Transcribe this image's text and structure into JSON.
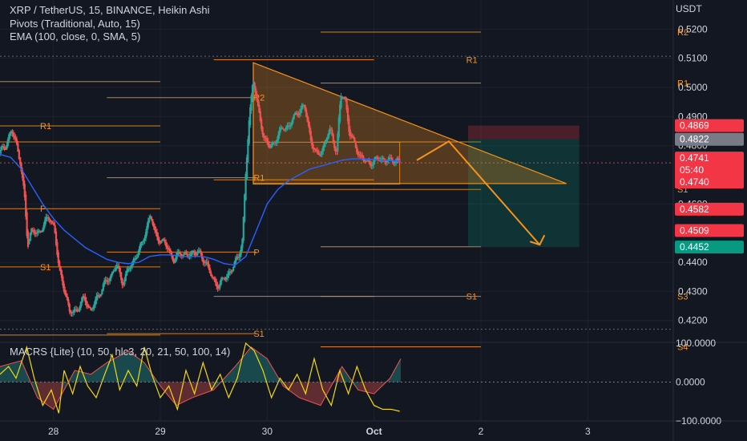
{
  "legend": {
    "symbol": "XRP / TetherUS, 15, BINANCE, Heikin Ashi",
    "pivots": "Pivots (Traditional, Auto, 15)",
    "ema": "EMA (100, close, 0, SMA, 5)",
    "macrs": "MACRS {Lite} (10, 50, hlc3, 20, 21, 50, 100, 14)"
  },
  "colors": {
    "background": "#131722",
    "bull": "#26a69a",
    "bear": "#ef5350",
    "ema": "#2962ff",
    "pivot": "#f7931a",
    "triangle_fill": "#f7931a",
    "stop_zone": "#f23645",
    "target_zone": "#089981"
  },
  "chart_data": [
    {
      "type": "candlestick",
      "title": "XRP / TetherUS, 15, BINANCE, Heikin Ashi",
      "ylabel": "USDT",
      "ylim": [
        0.4125,
        0.53
      ],
      "y_ticks": [
        "0.5200",
        "0.5100",
        "0.5000",
        "0.4900",
        "0.4800",
        "0.4600",
        "0.4400",
        "0.4300",
        "0.4200"
      ],
      "x_ticks": [
        "28",
        "29",
        "30",
        "Oct",
        "2",
        "3"
      ],
      "x_tick_pos": [
        0.5,
        1.5,
        2.5,
        3.5,
        4.5,
        5.5
      ],
      "xlim": [
        0.0,
        6.3
      ],
      "price_path": [
        [
          0.0,
          0.4775
        ],
        [
          0.06,
          0.48
        ],
        [
          0.12,
          0.485
        ],
        [
          0.16,
          0.4815
        ],
        [
          0.2,
          0.4745
        ],
        [
          0.24,
          0.462
        ],
        [
          0.27,
          0.446
        ],
        [
          0.3,
          0.451
        ],
        [
          0.36,
          0.4495
        ],
        [
          0.42,
          0.453
        ],
        [
          0.47,
          0.4555
        ],
        [
          0.52,
          0.452
        ],
        [
          0.56,
          0.438
        ],
        [
          0.62,
          0.43
        ],
        [
          0.66,
          0.4225
        ],
        [
          0.74,
          0.424
        ],
        [
          0.8,
          0.428
        ],
        [
          0.86,
          0.423
        ],
        [
          0.92,
          0.428
        ],
        [
          0.98,
          0.432
        ],
        [
          1.04,
          0.435
        ],
        [
          1.1,
          0.439
        ],
        [
          1.16,
          0.433
        ],
        [
          1.22,
          0.438
        ],
        [
          1.28,
          0.442
        ],
        [
          1.34,
          0.446
        ],
        [
          1.38,
          0.452
        ],
        [
          1.42,
          0.456
        ],
        [
          1.46,
          0.45
        ],
        [
          1.52,
          0.447
        ],
        [
          1.58,
          0.4455
        ],
        [
          1.64,
          0.44
        ],
        [
          1.7,
          0.444
        ],
        [
          1.76,
          0.4415
        ],
        [
          1.82,
          0.444
        ],
        [
          1.88,
          0.4425
        ],
        [
          1.94,
          0.44
        ],
        [
          2.0,
          0.434
        ],
        [
          2.06,
          0.432
        ],
        [
          2.12,
          0.435
        ],
        [
          2.18,
          0.4375
        ],
        [
          2.24,
          0.442
        ],
        [
          2.28,
          0.448
        ],
        [
          2.31,
          0.47
        ],
        [
          2.34,
          0.488
        ],
        [
          2.38,
          0.504
        ],
        [
          2.42,
          0.493
        ],
        [
          2.48,
          0.483
        ],
        [
          2.54,
          0.479
        ],
        [
          2.6,
          0.483
        ],
        [
          2.66,
          0.486
        ],
        [
          2.72,
          0.487
        ],
        [
          2.8,
          0.492
        ],
        [
          2.86,
          0.4935
        ],
        [
          2.92,
          0.482
        ],
        [
          2.98,
          0.476
        ],
        [
          3.04,
          0.48
        ],
        [
          3.1,
          0.4855
        ],
        [
          3.16,
          0.478
        ],
        [
          3.2,
          0.497
        ],
        [
          3.24,
          0.497
        ],
        [
          3.28,
          0.484
        ],
        [
          3.34,
          0.48
        ],
        [
          3.38,
          0.476
        ],
        [
          3.44,
          0.4745
        ],
        [
          3.5,
          0.474
        ],
        [
          3.56,
          0.476
        ],
        [
          3.62,
          0.4745
        ],
        [
          3.68,
          0.4755
        ],
        [
          3.74,
          0.4741
        ]
      ],
      "ema_path": [
        [
          0.0,
          0.477
        ],
        [
          0.1,
          0.476
        ],
        [
          0.2,
          0.472
        ],
        [
          0.3,
          0.466
        ],
        [
          0.4,
          0.46
        ],
        [
          0.5,
          0.455
        ],
        [
          0.6,
          0.451
        ],
        [
          0.7,
          0.448
        ],
        [
          0.8,
          0.445
        ],
        [
          0.9,
          0.443
        ],
        [
          1.0,
          0.441
        ],
        [
          1.1,
          0.44
        ],
        [
          1.2,
          0.4395
        ],
        [
          1.3,
          0.44
        ],
        [
          1.4,
          0.442
        ],
        [
          1.5,
          0.4425
        ],
        [
          1.6,
          0.4425
        ],
        [
          1.7,
          0.442
        ],
        [
          1.8,
          0.442
        ],
        [
          1.9,
          0.442
        ],
        [
          2.0,
          0.441
        ],
        [
          2.1,
          0.4395
        ],
        [
          2.2,
          0.439
        ],
        [
          2.3,
          0.442
        ],
        [
          2.4,
          0.451
        ],
        [
          2.5,
          0.46
        ],
        [
          2.6,
          0.465
        ],
        [
          2.7,
          0.468
        ],
        [
          2.8,
          0.47
        ],
        [
          2.9,
          0.472
        ],
        [
          3.0,
          0.473
        ],
        [
          3.1,
          0.474
        ],
        [
          3.2,
          0.475
        ],
        [
          3.3,
          0.4755
        ],
        [
          3.4,
          0.4755
        ],
        [
          3.5,
          0.4752
        ],
        [
          3.6,
          0.475
        ],
        [
          3.7,
          0.4748
        ],
        [
          3.75,
          0.4747
        ]
      ],
      "pivot_sets": [
        {
          "x0": 0.0,
          "x1": 1.5,
          "levels": [
            {
              "label": "R1",
              "value": 0.4868
            },
            {
              "label": "P",
              "value": 0.4584
            },
            {
              "label": "S1",
              "value": 0.4384
            },
            {
              "label": "",
              "value": 0.415
            },
            {
              "label": "",
              "value": 0.502
            },
            {
              "label": "",
              "value": 0.4813
            }
          ]
        },
        {
          "x0": 1.0,
          "x1": 2.4,
          "levels": [
            {
              "label": "R2",
              "value": 0.4965
            },
            {
              "label": "R1",
              "value": 0.469
            },
            {
              "label": "P",
              "value": 0.4435
            },
            {
              "label": "S1",
              "value": 0.4155
            }
          ]
        },
        {
          "x0": 2.0,
          "x1": 3.5,
          "levels": [
            {
              "label": "R1",
              "value": 0.5095
            },
            {
              "label": "",
              "value": 0.4683
            },
            {
              "label": "S1",
              "value": 0.4283
            }
          ]
        },
        {
          "x0": 3.0,
          "x1": 4.5,
          "levels": [
            {
              "label": "R2",
              "value": 0.519
            },
            {
              "label": "R1",
              "value": 0.5015
            },
            {
              "label": "",
              "value": 0.4813
            },
            {
              "label": "S1",
              "value": 0.465
            },
            {
              "label": "S2",
              "value": 0.4453
            },
            {
              "label": "S3",
              "value": 0.4283
            },
            {
              "label": "S4",
              "value": 0.411
            }
          ]
        }
      ],
      "triangle": [
        [
          2.37,
          0.5085
        ],
        [
          5.3,
          0.467
        ],
        [
          2.37,
          0.467
        ]
      ],
      "range_box": [
        2.37,
        3.74,
        0.4668,
        0.4812
      ],
      "position": {
        "x0": 4.38,
        "x1": 5.42,
        "entry": 0.4822,
        "stop": 0.4869,
        "target": 0.4452
      },
      "forecast_path": [
        [
          3.9,
          0.475
        ],
        [
          4.2,
          0.4815
        ],
        [
          5.05,
          0.446
        ]
      ],
      "price_badges": [
        {
          "text": "0.4869",
          "value": 0.4869,
          "color": "#f23645"
        },
        {
          "text": "0.4822",
          "value": 0.4822,
          "color": "#787b86"
        },
        {
          "text": "0.4741\n05:40\n0.4740",
          "value": 0.4741,
          "color": "#f23645"
        },
        {
          "text": "0.4582",
          "value": 0.4582,
          "color": "#f23645"
        },
        {
          "text": "0.4509",
          "value": 0.4509,
          "color": "#f23645"
        },
        {
          "text": "0.4452",
          "value": 0.4452,
          "color": "#089981"
        }
      ],
      "dotted_levels": [
        0.5107,
        0.4741,
        0.417
      ]
    },
    {
      "type": "area",
      "title": "MACRS {Lite} (10, 50, hlc3, 20, 21, 50, 100, 14)",
      "ylim": [
        -100,
        100
      ],
      "y_ticks": [
        "100.0000",
        "0.0000",
        "−100.0000"
      ],
      "y_tick_values": [
        100,
        0,
        -100
      ],
      "histogram": [
        [
          0.0,
          40
        ],
        [
          0.2,
          55
        ],
        [
          0.35,
          -40
        ],
        [
          0.5,
          -70
        ],
        [
          0.6,
          -20
        ],
        [
          0.7,
          30
        ],
        [
          0.85,
          20
        ],
        [
          1.0,
          50
        ],
        [
          1.2,
          80
        ],
        [
          1.35,
          50
        ],
        [
          1.5,
          -10
        ],
        [
          1.65,
          -60
        ],
        [
          1.8,
          -40
        ],
        [
          2.0,
          -20
        ],
        [
          2.2,
          40
        ],
        [
          2.35,
          90
        ],
        [
          2.5,
          60
        ],
        [
          2.65,
          -10
        ],
        [
          2.8,
          -40
        ],
        [
          3.0,
          -60
        ],
        [
          3.2,
          40
        ],
        [
          3.35,
          -20
        ],
        [
          3.5,
          -30
        ],
        [
          3.65,
          10
        ],
        [
          3.75,
          60
        ]
      ],
      "signal": [
        [
          0.0,
          20
        ],
        [
          0.08,
          40
        ],
        [
          0.15,
          10
        ],
        [
          0.25,
          90
        ],
        [
          0.32,
          10
        ],
        [
          0.4,
          -60
        ],
        [
          0.48,
          -20
        ],
        [
          0.55,
          -80
        ],
        [
          0.6,
          30
        ],
        [
          0.68,
          -30
        ],
        [
          0.75,
          40
        ],
        [
          0.82,
          -10
        ],
        [
          0.9,
          -40
        ],
        [
          0.98,
          20
        ],
        [
          1.05,
          70
        ],
        [
          1.12,
          -20
        ],
        [
          1.2,
          30
        ],
        [
          1.28,
          -10
        ],
        [
          1.35,
          90
        ],
        [
          1.42,
          20
        ],
        [
          1.5,
          -40
        ],
        [
          1.58,
          -10
        ],
        [
          1.66,
          -70
        ],
        [
          1.74,
          30
        ],
        [
          1.82,
          -30
        ],
        [
          1.9,
          50
        ],
        [
          1.98,
          -20
        ],
        [
          2.06,
          20
        ],
        [
          2.14,
          -40
        ],
        [
          2.22,
          10
        ],
        [
          2.3,
          100
        ],
        [
          2.38,
          80
        ],
        [
          2.46,
          30
        ],
        [
          2.54,
          -40
        ],
        [
          2.62,
          10
        ],
        [
          2.7,
          -20
        ],
        [
          2.78,
          20
        ],
        [
          2.86,
          -30
        ],
        [
          2.94,
          60
        ],
        [
          3.02,
          -20
        ],
        [
          3.1,
          -60
        ],
        [
          3.18,
          30
        ],
        [
          3.26,
          -30
        ],
        [
          3.34,
          40
        ],
        [
          3.42,
          -20
        ],
        [
          3.5,
          -60
        ],
        [
          3.58,
          -70
        ],
        [
          3.66,
          -70
        ],
        [
          3.74,
          -75
        ]
      ]
    }
  ]
}
